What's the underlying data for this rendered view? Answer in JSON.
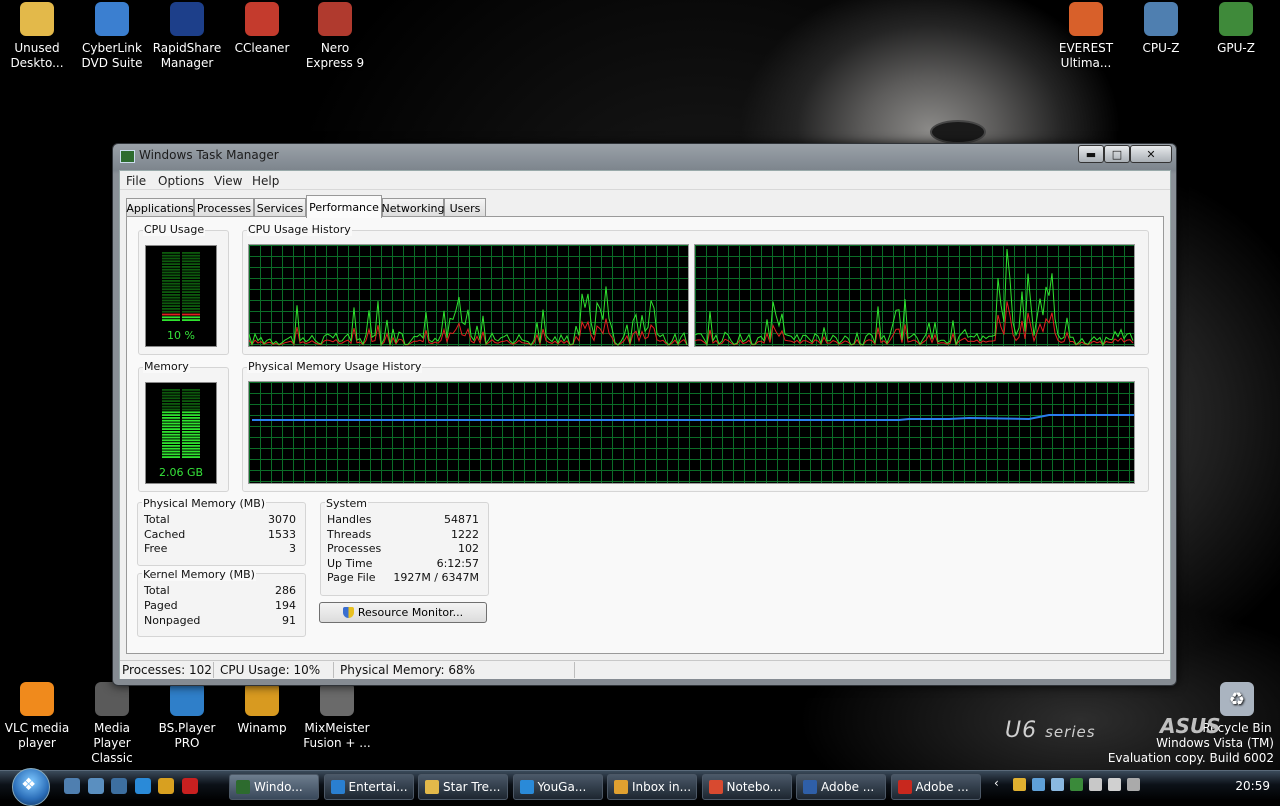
{
  "desktop": {
    "top_left_icons": [
      {
        "label": "Unused Deskto...",
        "icon": "folder-icon",
        "color": "#e3b94a"
      },
      {
        "label": "CyberLink DVD Suite",
        "icon": "cyberlink-icon",
        "color": "#3b7fd0"
      },
      {
        "label": "RapidShare Manager",
        "icon": "rapidshare-icon",
        "color": "#1d3f8a"
      },
      {
        "label": "CCleaner",
        "icon": "ccleaner-icon",
        "color": "#c43b2d"
      },
      {
        "label": "Nero Express 9",
        "icon": "nero-icon",
        "color": "#b03a2e"
      }
    ],
    "top_right_icons": [
      {
        "label": "EVEREST Ultima...",
        "icon": "everest-icon",
        "color": "#d8602a"
      },
      {
        "label": "CPU-Z",
        "icon": "cpuz-icon",
        "color": "#4f7fb0"
      },
      {
        "label": "GPU-Z",
        "icon": "gpuz-icon",
        "color": "#3f8a3a"
      }
    ],
    "bottom_left_icons": [
      {
        "label": "VLC media player",
        "icon": "vlc-icon",
        "color": "#f08a1c"
      },
      {
        "label": "Media Player Classic",
        "icon": "mpc-icon",
        "color": "#5a5a5a"
      },
      {
        "label": "BS.Player PRO",
        "icon": "bsplayer-icon",
        "color": "#2f7fc9"
      },
      {
        "label": "Winamp",
        "icon": "winamp-icon",
        "color": "#d89a20"
      },
      {
        "label": "MixMeister Fusion + ...",
        "icon": "mixmeister-icon",
        "color": "#6a6a6a"
      }
    ],
    "recycle_bin": {
      "label": "Recycle Bin",
      "icon": "recycle-bin-icon",
      "color": "#aab4c0"
    },
    "branding": {
      "u6": "U6",
      "series": "series",
      "asus": "ASUS"
    },
    "watermark": [
      "Windows Vista (TM)",
      "Evaluation copy. Build 6002"
    ]
  },
  "window": {
    "title": "Windows Task Manager",
    "menu": [
      "File",
      "Options",
      "View",
      "Help"
    ],
    "tabs": [
      "Applications",
      "Processes",
      "Services",
      "Performance",
      "Networking",
      "Users"
    ],
    "active_tab": "Performance",
    "cpu_usage": {
      "label": "CPU Usage",
      "value_text": "10 %",
      "percent": 10
    },
    "cpu_history": {
      "label": "CPU Usage History"
    },
    "memory": {
      "label": "Memory",
      "value_text": "2.06 GB",
      "percent": 68
    },
    "memory_history": {
      "label": "Physical Memory Usage History"
    },
    "physical_memory": {
      "title": "Physical Memory (MB)",
      "rows": [
        {
          "key": "Total",
          "value": "3070"
        },
        {
          "key": "Cached",
          "value": "1533"
        },
        {
          "key": "Free",
          "value": "3"
        }
      ]
    },
    "kernel_memory": {
      "title": "Kernel Memory (MB)",
      "rows": [
        {
          "key": "Total",
          "value": "286"
        },
        {
          "key": "Paged",
          "value": "194"
        },
        {
          "key": "Nonpaged",
          "value": "91"
        }
      ]
    },
    "system": {
      "title": "System",
      "rows": [
        {
          "key": "Handles",
          "value": "54871"
        },
        {
          "key": "Threads",
          "value": "1222"
        },
        {
          "key": "Processes",
          "value": "102"
        },
        {
          "key": "Up Time",
          "value": "6:12:57"
        },
        {
          "key": "Page File",
          "value": "1927M / 6347M"
        }
      ]
    },
    "resource_monitor_button": "Resource Monitor...",
    "status_bar": [
      "Processes: 102",
      "CPU Usage: 10%",
      "Physical Memory: 68%"
    ]
  },
  "taskbar": {
    "quick_launch": [
      {
        "icon": "show-desktop-icon",
        "color": "#4f7fb0"
      },
      {
        "icon": "switch-windows-icon",
        "color": "#5a8fc0"
      },
      {
        "icon": "explorer-icon",
        "color": "#3d6fa0"
      },
      {
        "icon": "internet-explorer-icon",
        "color": "#2a8ad8"
      },
      {
        "icon": "chrome-icon",
        "color": "#d8a020"
      },
      {
        "icon": "opera-icon",
        "color": "#c82020"
      }
    ],
    "tasks": [
      {
        "label": "Windo...",
        "icon": "task-manager-icon",
        "color": "#2d6b2e",
        "active": true
      },
      {
        "label": "Entertai...",
        "icon": "window-icon",
        "color": "#2a7fd0",
        "active": false
      },
      {
        "label": "Star Tre...",
        "icon": "folder-icon",
        "color": "#e3b94a",
        "active": false
      },
      {
        "label": "YouGa...",
        "icon": "internet-explorer-icon",
        "color": "#2a8ad8",
        "active": false
      },
      {
        "label": "Inbox in...",
        "icon": "mail-icon",
        "color": "#e0a030",
        "active": false
      },
      {
        "label": "Notebo...",
        "icon": "chrome-icon",
        "color": "#d84a30",
        "active": false
      },
      {
        "label": "Adobe ...",
        "icon": "photoshop-icon",
        "color": "#2f5fa8",
        "active": false
      },
      {
        "label": "Adobe ...",
        "icon": "acrobat-icon",
        "color": "#c8281e",
        "active": false
      }
    ],
    "tray_icons": [
      "chevron-left-icon",
      "messenger-icon",
      "network-icon",
      "volume-icon",
      "shield-icon",
      "update-icon",
      "battery-icon",
      "display-icon"
    ],
    "clock": "20:59"
  }
}
